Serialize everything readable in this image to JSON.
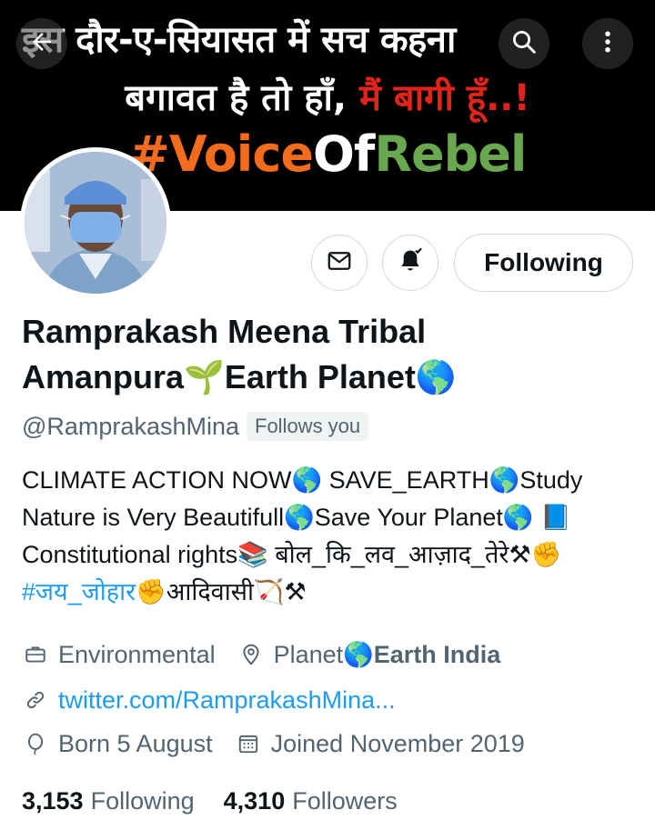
{
  "banner": {
    "line1": "इस दौर-ए-सियासत में सच कहना",
    "line2_white": "बगावत है तो हाँ, ",
    "line2_red": "मैं बागी हूँ..!",
    "tag_part1": "#Voice",
    "tag_part2": "Of",
    "tag_part3": "Rebel"
  },
  "header": {
    "back_icon": "arrow-left-icon",
    "search_icon": "search-icon",
    "more_icon": "more-vertical-icon"
  },
  "actions": {
    "message_icon": "envelope-icon",
    "notify_icon": "bell-check-icon",
    "follow_label": "Following"
  },
  "profile": {
    "name_line1": "Ramprakash Meena Tribal",
    "name_line2": "Amanpura🌱Earth Planet🌎",
    "handle": "@RamprakashMina",
    "follows_you": "Follows you"
  },
  "bio": {
    "line1": "CLIMATE ACTION NOW🌎  SAVE_EARTH🌎Study",
    "line2": "Nature is Very Beautifull🌎Save Your Planet🌎 📘",
    "line3": "Constitutional rights📚 बोल_कि_लव_आज़ाद_तेरे⚒✊",
    "line4_hashtag": "#जय_जोहार",
    "line4_rest": "✊आदिवासी🏹⚒"
  },
  "meta": {
    "profession": "Environmental",
    "location_plain": "Planet🌎",
    "location_bold": "Earth India",
    "website": "twitter.com/RamprakashMina...",
    "birthday": "Born 5 August",
    "joined": "Joined November 2019"
  },
  "stats": {
    "following_count": "3,153",
    "following_label": "Following",
    "followers_count": "4,310",
    "followers_label": "Followers"
  },
  "colors": {
    "accent": "#1d9bf0",
    "secondary_text": "#536471",
    "primary_text": "#0f1419",
    "banner_red": "#e0241b",
    "banner_orange": "#f36b1c",
    "banner_green": "#6aa84f"
  }
}
